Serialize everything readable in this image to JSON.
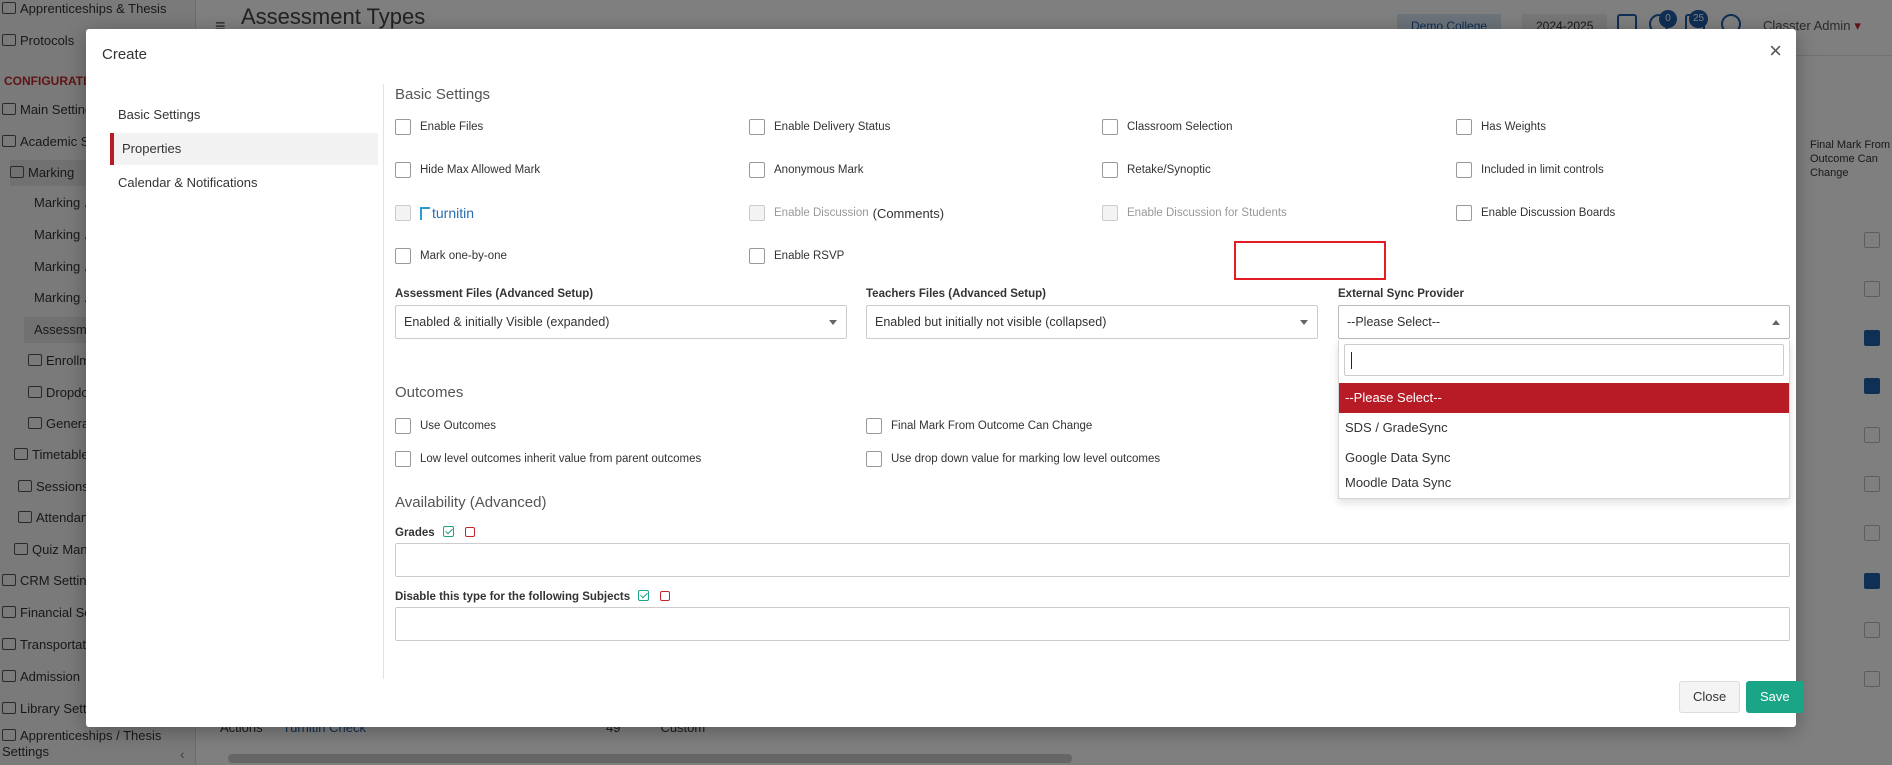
{
  "background": {
    "sidebar": {
      "items": [
        {
          "label": "Apprenticeships & Thesis"
        },
        {
          "label": "Protocols"
        },
        {
          "label": "CONFIGURATION"
        },
        {
          "label": "Main Settings"
        },
        {
          "label": "Academic Settings"
        },
        {
          "label": "Marking"
        },
        {
          "label": "Marking ..."
        },
        {
          "label": "Marking ..."
        },
        {
          "label": "Marking ..."
        },
        {
          "label": "Marking ..."
        },
        {
          "label": "Assessment Types"
        },
        {
          "label": "Enrollment"
        },
        {
          "label": "Dropdowns"
        },
        {
          "label": "General"
        },
        {
          "label": "Timetable"
        },
        {
          "label": "Sessions"
        },
        {
          "label": "Attendance"
        },
        {
          "label": "Quiz Manager"
        },
        {
          "label": "CRM Settings"
        },
        {
          "label": "Financial Settings"
        },
        {
          "label": "Transportation"
        },
        {
          "label": "Admission"
        },
        {
          "label": "Library Settings"
        },
        {
          "label": "Apprenticeships / Thesis Settings"
        }
      ],
      "collapse_glyph": "‹"
    },
    "topbar": {
      "menu_glyph": "≡",
      "title": "Assessment Types",
      "college": "Demo College",
      "year": "2024-2025",
      "badge_notifications": "0",
      "badge_messages": "25",
      "user": "Classter Admin"
    },
    "table": {
      "column_header": "Final Mark From Outcome Can Change",
      "row_actions": "Actions",
      "row_name": "Turnitin Check",
      "row_number": "49",
      "row_type": "Custom"
    }
  },
  "modal": {
    "title": "Create",
    "close_glyph": "×",
    "nav": [
      {
        "label": "Basic Settings",
        "active": false
      },
      {
        "label": "Properties",
        "active": true
      },
      {
        "label": "Calendar & Notifications",
        "active": false
      }
    ],
    "basic_settings": {
      "title": "Basic Settings",
      "checkboxes": [
        {
          "label": "Enable Files",
          "disabled": false
        },
        {
          "label": "Enable Delivery Status",
          "disabled": false
        },
        {
          "label": "Classroom Selection",
          "disabled": false
        },
        {
          "label": "Has Weights",
          "disabled": false
        },
        {
          "label": "Hide Max Allowed Mark",
          "disabled": false
        },
        {
          "label": "Anonymous Mark",
          "disabled": false
        },
        {
          "label": "Retake/Synoptic",
          "disabled": false
        },
        {
          "label": "Included in limit controls",
          "disabled": false
        },
        {
          "label": "turnitin",
          "disabled": true
        },
        {
          "label": "Enable Discussion",
          "extra": "(Comments)",
          "disabled": true
        },
        {
          "label": "Enable Discussion for Students",
          "disabled": true
        },
        {
          "label": "Enable Discussion Boards",
          "disabled": false
        },
        {
          "label": "Mark one-by-one",
          "disabled": false
        },
        {
          "label": "Enable RSVP",
          "disabled": false
        }
      ]
    },
    "assessment_files": {
      "label": "Assessment Files (Advanced Setup)",
      "value": "Enabled & initially Visible (expanded)"
    },
    "teachers_files": {
      "label": "Teachers Files (Advanced Setup)",
      "value": "Enabled but initially not visible (collapsed)"
    },
    "external_sync": {
      "label": "External Sync Provider",
      "value": "--Please Select--",
      "search_value": "",
      "options": [
        "--Please Select--",
        "SDS / GradeSync",
        "Google Data Sync",
        "Moodle Data Sync"
      ],
      "selected_index": 0
    },
    "outcomes": {
      "title": "Outcomes",
      "checkboxes": [
        {
          "label": "Use Outcomes"
        },
        {
          "label": "Final Mark From Outcome Can Change"
        },
        {
          "label": "Low level outcomes inherit value from parent outcomes"
        },
        {
          "label": "Use drop down value for marking low level outcomes"
        }
      ]
    },
    "availability": {
      "title": "Availability (Advanced)",
      "grades_label": "Grades",
      "subjects_label": "Disable this type for the following Subjects"
    },
    "buttons": {
      "close": "Close",
      "save": "Save"
    },
    "colors": {
      "accent_red": "#b71c26",
      "highlight_red": "#e11c24",
      "save_green": "#1aa587"
    }
  }
}
